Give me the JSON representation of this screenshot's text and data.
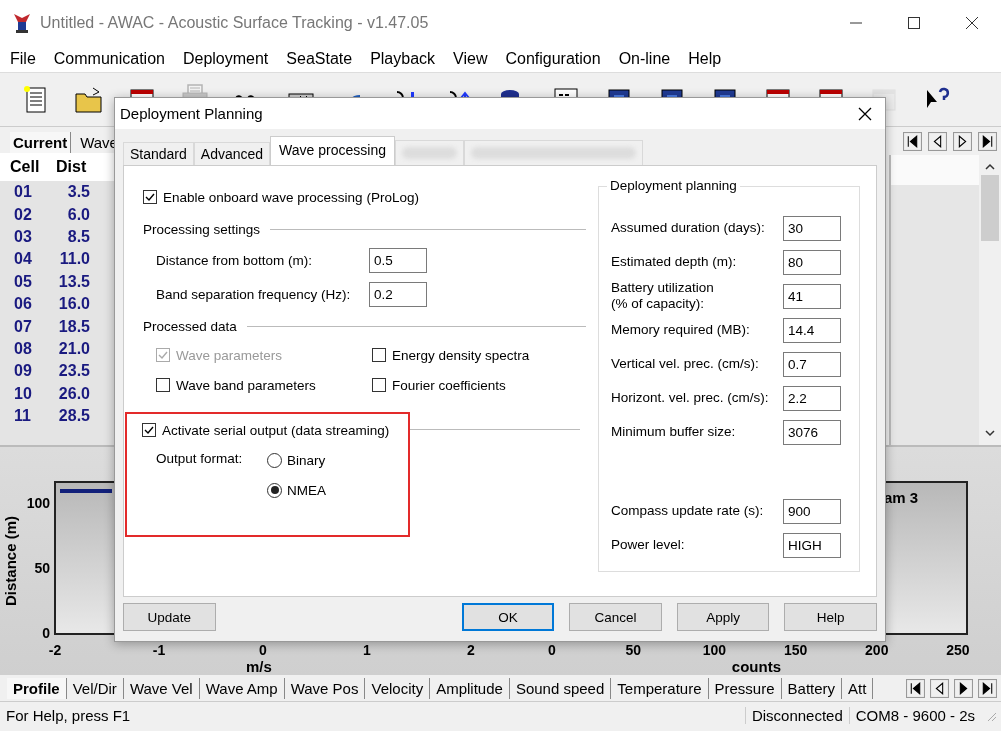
{
  "window": {
    "title": "Untitled - AWAC - Acoustic Surface Tracking - v1.47.05"
  },
  "menu": [
    "File",
    "Communication",
    "Deployment",
    "SeaState",
    "Playback",
    "View",
    "Configuration",
    "On-line",
    "Help"
  ],
  "toolbar": [
    {
      "kind": "document",
      "disabled": false
    },
    {
      "kind": "folder",
      "disabled": false
    },
    {
      "kind": "window",
      "disabled": false
    },
    {
      "kind": "printer",
      "disabled": true
    },
    {
      "kind": "probe",
      "disabled": false
    },
    {
      "kind": "tool",
      "disabled": false
    },
    {
      "kind": "signal",
      "disabled": false
    },
    {
      "kind": "down",
      "disabled": false
    },
    {
      "kind": "up",
      "disabled": false
    },
    {
      "kind": "disk",
      "disabled": false
    },
    {
      "kind": "binary",
      "disabled": false
    },
    {
      "kind": "chip",
      "disabled": false
    },
    {
      "kind": "chip",
      "disabled": false
    },
    {
      "kind": "chip",
      "disabled": false
    },
    {
      "kind": "window",
      "disabled": false
    },
    {
      "kind": "window",
      "disabled": false
    },
    {
      "kind": "window",
      "disabled": true
    },
    {
      "kind": "help",
      "disabled": false
    }
  ],
  "data_panel": {
    "tabs": [
      {
        "label": "Current",
        "selected": true
      },
      {
        "label": "Wave",
        "selected": false
      }
    ],
    "columns": [
      "Cell",
      "Dist"
    ],
    "rows": [
      [
        "01",
        "3.5"
      ],
      [
        "02",
        "6.0"
      ],
      [
        "03",
        "8.5"
      ],
      [
        "04",
        "11.0"
      ],
      [
        "05",
        "13.5"
      ],
      [
        "06",
        "16.0"
      ],
      [
        "07",
        "18.5"
      ],
      [
        "08",
        "21.0"
      ],
      [
        "09",
        "23.5"
      ],
      [
        "10",
        "26.0"
      ],
      [
        "11",
        "28.5"
      ]
    ]
  },
  "charts": [
    {
      "ylabel": "Distance (m)",
      "yticks": [
        "100",
        "50",
        "0"
      ],
      "xticks": [
        "-2",
        "-1",
        "0",
        "1",
        "2"
      ],
      "xlabel": "m/s"
    },
    {
      "title": "am 3",
      "xticks": [
        "0",
        "50",
        "100",
        "150",
        "200",
        "250"
      ],
      "xlabel": "counts"
    }
  ],
  "view_tabs": [
    {
      "label": "Profile",
      "selected": true
    },
    {
      "label": "Vel/Dir",
      "selected": false
    },
    {
      "label": "Wave Vel",
      "selected": false
    },
    {
      "label": "Wave Amp",
      "selected": false
    },
    {
      "label": "Wave Pos",
      "selected": false
    },
    {
      "label": "Velocity",
      "selected": false
    },
    {
      "label": "Amplitude",
      "selected": false
    },
    {
      "label": "Sound speed",
      "selected": false
    },
    {
      "label": "Temperature",
      "selected": false
    },
    {
      "label": "Pressure",
      "selected": false
    },
    {
      "label": "Battery",
      "selected": false
    },
    {
      "label": "Att",
      "selected": false
    }
  ],
  "status_bar": {
    "help": "For Help, press F1",
    "connection": "Disconnected",
    "port": "COM8 - 9600 - 2s"
  },
  "dialog": {
    "title": "Deployment Planning",
    "tabs": [
      {
        "label": "Standard",
        "selected": false
      },
      {
        "label": "Advanced",
        "selected": false
      },
      {
        "label": "Wave processing",
        "selected": true
      }
    ],
    "enable": {
      "label": "Enable onboard wave processing (ProLog)",
      "checked": true
    },
    "processing_settings": {
      "title": "Processing settings",
      "fields": [
        {
          "label": "Distance from bottom (m):",
          "value": "0.5"
        },
        {
          "label": "Band separation frequency (Hz):",
          "value": "0.2"
        }
      ]
    },
    "processed_data": {
      "title": "Processed data",
      "options": [
        {
          "label": "Wave parameters",
          "checked": true,
          "disabled": true
        },
        {
          "label": "Energy density spectra",
          "checked": false,
          "disabled": false
        },
        {
          "label": "Wave band parameters",
          "checked": false,
          "disabled": false
        },
        {
          "label": "Fourier coefficients",
          "checked": false,
          "disabled": false
        }
      ]
    },
    "serial_output": {
      "label": "Activate serial output (data streaming)",
      "checked": true,
      "format_label": "Output format:",
      "formats": [
        {
          "label": "Binary",
          "selected": false
        },
        {
          "label": "NMEA",
          "selected": true
        }
      ]
    },
    "planning": {
      "title": "Deployment planning",
      "fields": [
        {
          "label": "Assumed duration (days):",
          "value": "30"
        },
        {
          "label": "Estimated depth (m):",
          "value": "80"
        },
        {
          "label": "Battery utilization\n(% of capacity):",
          "value": "41"
        },
        {
          "label": "Memory required (MB):",
          "value": "14.4"
        },
        {
          "label": "Vertical vel. prec. (cm/s):",
          "value": "0.7"
        },
        {
          "label": "Horizont. vel. prec. (cm/s):",
          "value": "2.2"
        },
        {
          "label": "Minimum buffer size:",
          "value": "3076"
        }
      ],
      "settings": [
        {
          "label": "Compass update rate (s):",
          "value": "900"
        },
        {
          "label": "Power level:",
          "value": "HIGH"
        }
      ]
    },
    "buttons": [
      {
        "label": "Update",
        "default": false
      },
      {
        "label": "OK",
        "default": true
      },
      {
        "label": "Cancel",
        "default": false
      },
      {
        "label": "Apply",
        "default": false
      },
      {
        "label": "Help",
        "default": false
      }
    ]
  }
}
